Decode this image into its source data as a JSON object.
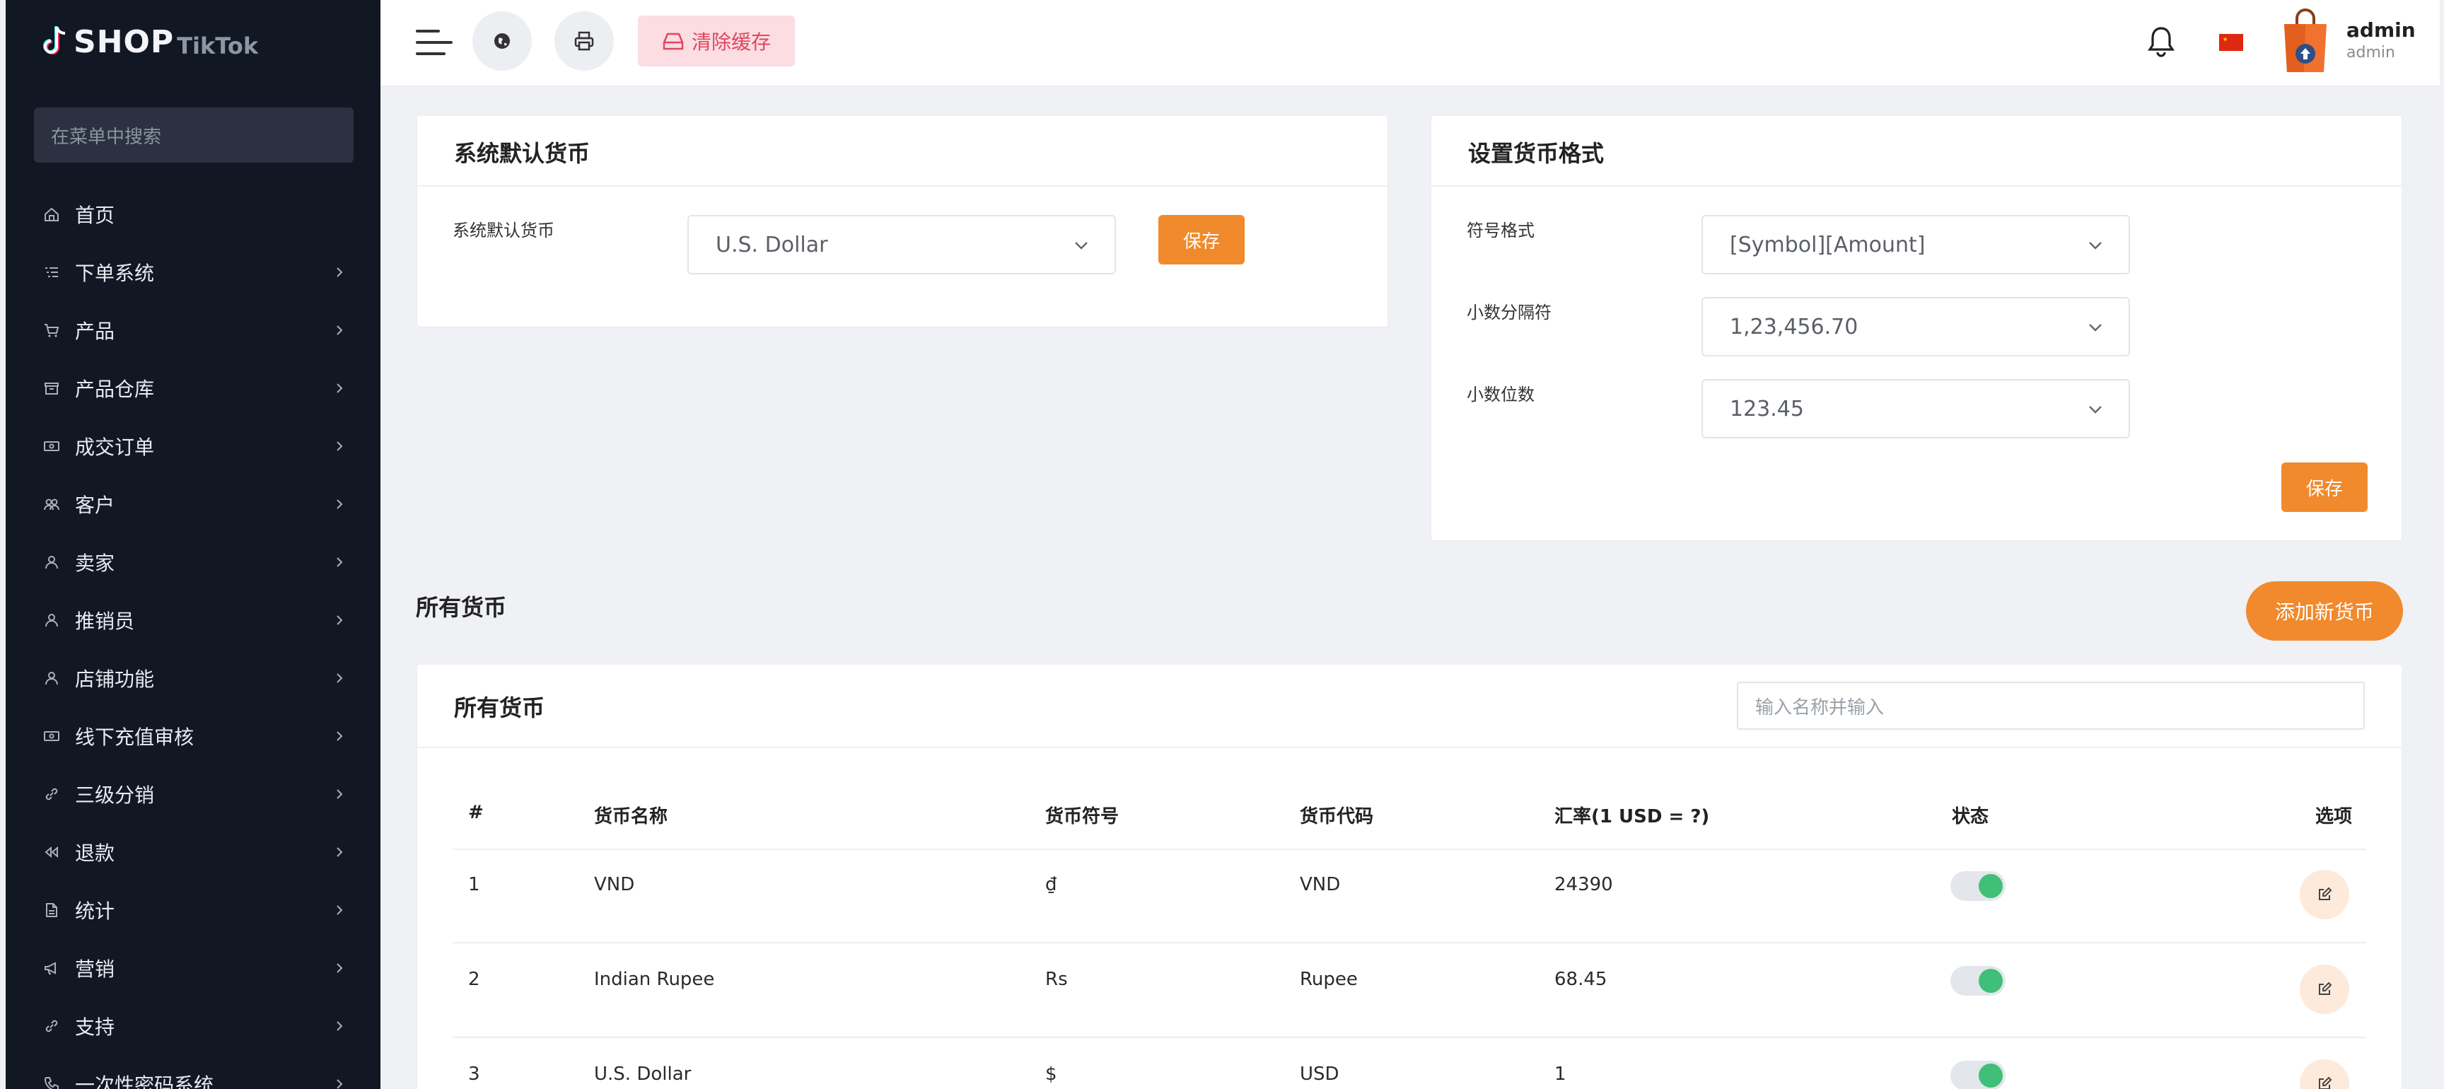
{
  "sidebar": {
    "logo": {
      "main": "SHOP",
      "sub": "TikTok"
    },
    "search_placeholder": "在菜单中搜索",
    "items": [
      {
        "label": "首页",
        "icon": "home-icon",
        "has_children": false
      },
      {
        "label": "下单系统",
        "icon": "list-icon",
        "has_children": true
      },
      {
        "label": "产品",
        "icon": "cart-icon",
        "has_children": true
      },
      {
        "label": "产品仓库",
        "icon": "warehouse-icon",
        "has_children": true
      },
      {
        "label": "成交订单",
        "icon": "money-icon",
        "has_children": true
      },
      {
        "label": "客户",
        "icon": "users-icon",
        "has_children": true
      },
      {
        "label": "卖家",
        "icon": "user-icon",
        "has_children": true
      },
      {
        "label": "推销员",
        "icon": "user-icon",
        "has_children": true
      },
      {
        "label": "店铺功能",
        "icon": "user-icon",
        "has_children": true
      },
      {
        "label": "线下充值审核",
        "icon": "money-icon",
        "has_children": true
      },
      {
        "label": "三级分销",
        "icon": "link-icon",
        "has_children": true
      },
      {
        "label": "退款",
        "icon": "backward-icon",
        "has_children": true
      },
      {
        "label": "统计",
        "icon": "document-icon",
        "has_children": true
      },
      {
        "label": "营销",
        "icon": "megaphone-icon",
        "has_children": true
      },
      {
        "label": "支持",
        "icon": "link-icon",
        "has_children": true
      },
      {
        "label": "一次性密码系统",
        "icon": "phone-icon",
        "has_children": true
      }
    ]
  },
  "topbar": {
    "clear_cache_label": "清除缓存",
    "user_name": "admin",
    "user_role": "admin",
    "language": "zh-CN"
  },
  "default_currency_card": {
    "title": "系统默认货币",
    "field_label": "系统默认货币",
    "selected": "U.S. Dollar",
    "save_label": "保存"
  },
  "format_card": {
    "title": "设置货币格式",
    "symbol_format_label": "符号格式",
    "symbol_format_value": "[Symbol][Amount]",
    "decimal_separator_label": "小数分隔符",
    "decimal_separator_value": "1,23,456.70",
    "decimal_places_label": "小数位数",
    "decimal_places_value": "123.45",
    "save_label": "保存"
  },
  "all_currencies": {
    "section_title": "所有货币",
    "add_button_label": "添加新货币",
    "card_title": "所有货币",
    "search_placeholder": "输入名称并输入",
    "columns": [
      "#",
      "货币名称",
      "货币符号",
      "货币代码",
      "汇率(1 USD = ?)",
      "状态",
      "选项"
    ],
    "rows": [
      {
        "index": "1",
        "name": "VND",
        "symbol": "₫",
        "code": "VND",
        "rate": "24390",
        "enabled": true
      },
      {
        "index": "2",
        "name": "Indian Rupee",
        "symbol": "Rs",
        "code": "Rupee",
        "rate": "68.45",
        "enabled": true
      },
      {
        "index": "3",
        "name": "U.S. Dollar",
        "symbol": "$",
        "code": "USD",
        "rate": "1",
        "enabled": true
      }
    ]
  },
  "colors": {
    "sidebar_bg": "#111723",
    "accent_orange": "#f08a2c",
    "clear_cache_bg": "#fbdde2",
    "clear_cache_text": "#e0475f",
    "toggle_on": "#3fbf78"
  }
}
